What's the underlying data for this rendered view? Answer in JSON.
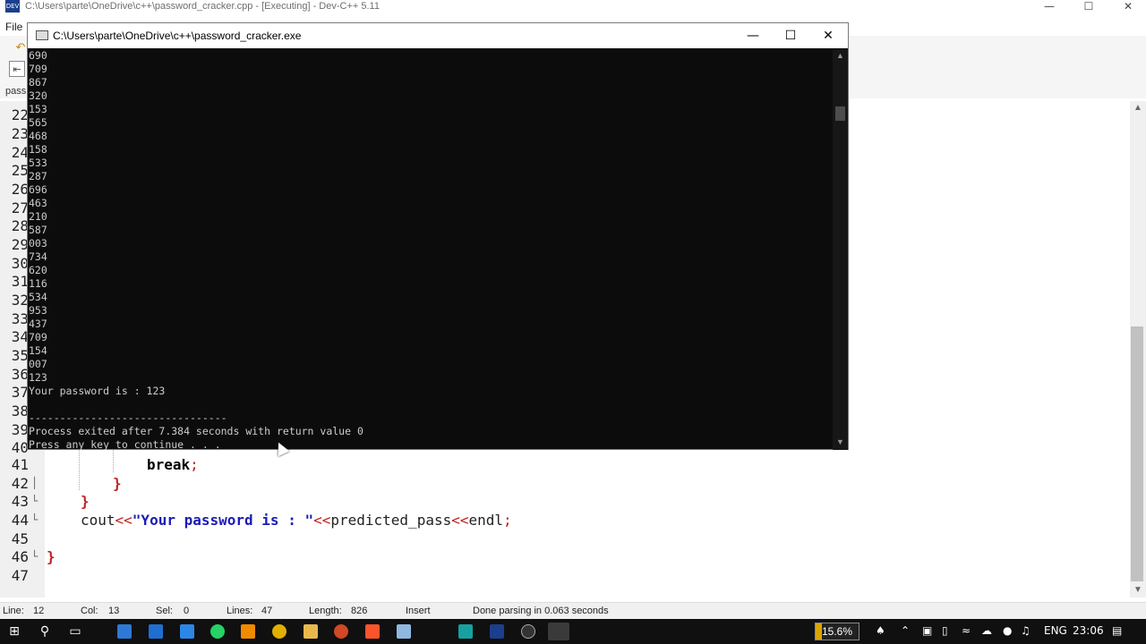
{
  "ide": {
    "title": "C:\\Users\\parte\\OneDrive\\c++\\password_cracker.cpp - [Executing] - Dev-C++ 5.11",
    "app_icon": "DEV",
    "menu_file": "File",
    "tab_label": "pass",
    "line_numbers": [
      "22",
      "23",
      "24",
      "25",
      "26",
      "27",
      "28",
      "29",
      "30",
      "31",
      "32",
      "33",
      "34",
      "35",
      "36",
      "37",
      "38",
      "39",
      "40",
      "41",
      "42",
      "43",
      "44",
      "45",
      "46",
      "47"
    ],
    "code": {
      "l41": "break",
      "l41_semi": ";",
      "l42": "}",
      "l43": "}",
      "l44_cout": "cout",
      "l44_op1": "<<",
      "l44_str": "\"Your password is : \"",
      "l44_op2": "<<",
      "l44_var": "predicted_pass",
      "l44_op3": "<<",
      "l44_endl": "endl",
      "l44_semi": ";",
      "l46": "}"
    }
  },
  "statusbar": {
    "line_label": "Line:",
    "line_value": "12",
    "col_label": "Col:",
    "col_value": "13",
    "sel_label": "Sel:",
    "sel_value": "0",
    "lines_label": "Lines:",
    "lines_value": "47",
    "length_label": "Length:",
    "length_value": "826",
    "mode": "Insert",
    "message": "Done parsing in 0.063 seconds"
  },
  "console": {
    "title": "C:\\Users\\parte\\OneDrive\\c++\\password_cracker.exe",
    "output": "690\n709\n867\n320\n153\n565\n468\n158\n533\n287\n696\n463\n210\n587\n003\n734\n620\n116\n534\n953\n437\n709\n154\n007\n123\nYour password is : 123\n\n--------------------------------\nProcess exited after 7.384 seconds with return value 0\nPress any key to continue . . ."
  },
  "taskbar": {
    "cpu_percent": 15.6,
    "cpu_label": "15.6%",
    "language": "ENG",
    "clock": "23:06",
    "apps": [
      "store",
      "mail",
      "files",
      "whatsapp",
      "vlc",
      "chrome",
      "explorer",
      "powerpoint",
      "brave",
      "notepad",
      "sublime",
      "devcpp",
      "clock",
      "console"
    ]
  },
  "icons": {
    "minimize": "minimize-icon",
    "maximize": "maximize-icon",
    "close": "close-icon"
  }
}
